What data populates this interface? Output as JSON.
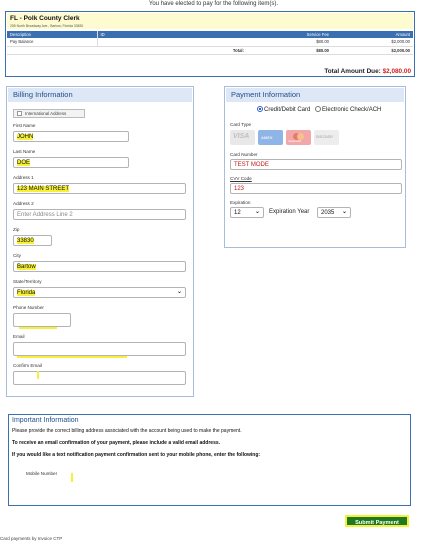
{
  "notice": "You have elected to pay for the following item(s).",
  "invoice": {
    "clerk": "FL - Polk County Clerk",
    "address": "255 North Broadway Ave., Bartow, Florida 33830",
    "columns": [
      "Description",
      "ID",
      "Service Fee",
      "Amount"
    ],
    "rows": [
      {
        "description": "Pay Balance",
        "id": "",
        "fee": "$80.00",
        "amount": "$2,000.00"
      }
    ],
    "total_label": "Total:",
    "total_fee": "$80.00",
    "total_amount": "$2,000.00",
    "due_label": "Total Amount Due:",
    "due_amount": "$2,080.00"
  },
  "billing": {
    "title": "Billing Information",
    "intl_label": "International Address",
    "first_name_label": "First Name",
    "first_name": "JOHN",
    "last_name_label": "Last Name",
    "last_name": "DOE",
    "address1_label": "Address 1",
    "address1": "123 MAIN STREET",
    "address2_label": "Address 2",
    "address2_placeholder": "Enter Address Line 2",
    "zip_label": "Zip",
    "zip": "33830",
    "city_label": "City",
    "city": "Bartow",
    "state_label": "State/Territory",
    "state": "Florida",
    "phone_label": "Phone Number",
    "phone": "",
    "email_label": "Email",
    "email": "",
    "confirm_email_label": "Confirm Email",
    "confirm_email": ""
  },
  "payment": {
    "title": "Payment Information",
    "method_card": "Credit/Debit Card",
    "method_ach": "Electronic Check/ACH",
    "card_type_label": "Card Type",
    "card_brands": [
      "VISA",
      "AMEX",
      "mastercard",
      "DISCOVER"
    ],
    "card_number_label": "Card Number",
    "card_number": "TEST MODE",
    "cvv_label": "CVV Code",
    "cvv": "123",
    "expiration_label": "Expiration",
    "exp_month": "12",
    "exp_year_label": "Expiration Year",
    "exp_year": "2035"
  },
  "info": {
    "title": "Important Information",
    "line1": "Please provide the correct billing address associated with the account being used to make the payment.",
    "line2": "To receive an email confirmation of your payment, please include a valid email address.",
    "line3": "If you would like a text notification payment confirmation sent to your mobile phone, enter the following:",
    "mobile_label": "Mobile Number"
  },
  "submit_label": "Submit Payment",
  "bottom_note": "Card payments by Invoice CTP"
}
